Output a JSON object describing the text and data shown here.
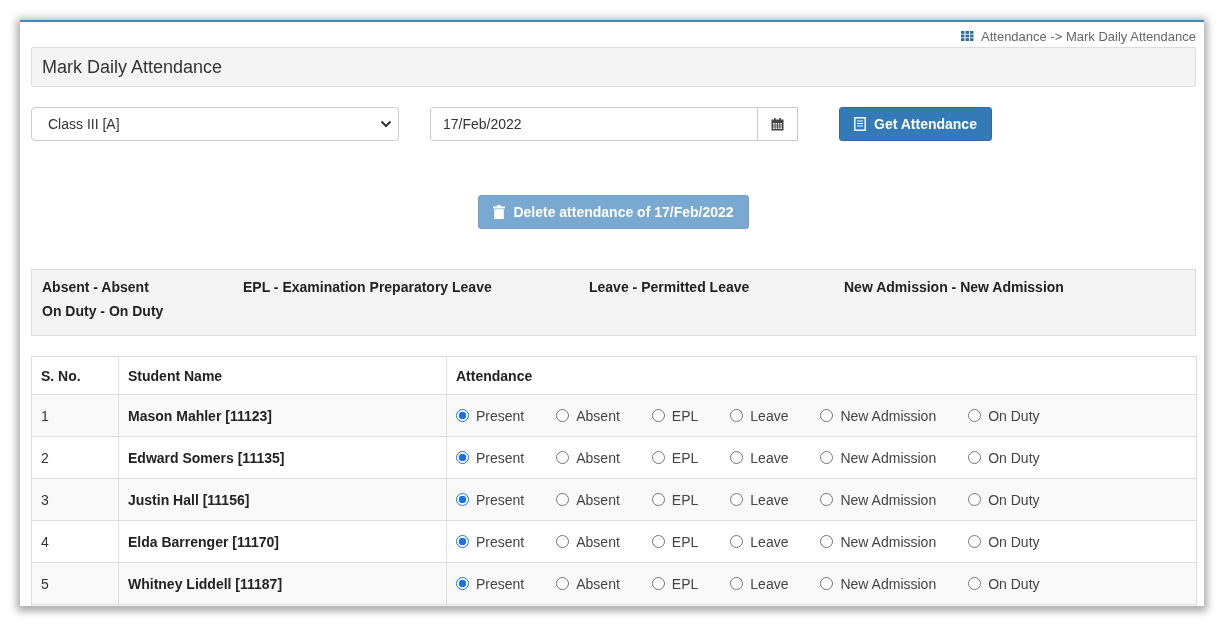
{
  "breadcrumb": "Attendance -> Mark Daily Attendance",
  "page_title": "Mark Daily Attendance",
  "class_select": {
    "value": "Class III [A]"
  },
  "date_field": {
    "value": "17/Feb/2022"
  },
  "get_button": "Get Attendance",
  "delete_button": {
    "label": "Delete attendance of 17/Feb/2022",
    "disabled": true
  },
  "legend": [
    "Absent - Absent",
    "EPL - Examination Preparatory Leave",
    "Leave - Permitted Leave",
    "New Admission - New Admission",
    "On Duty - On Duty"
  ],
  "table": {
    "columns": [
      "S. No.",
      "Student Name",
      "Attendance"
    ],
    "rows": [
      {
        "sno": "1",
        "name": "Mason Mahler [11123]",
        "options": [
          {
            "label": "Present",
            "selected": true
          },
          {
            "label": "Absent",
            "selected": false
          },
          {
            "label": "EPL",
            "selected": false
          },
          {
            "label": "Leave",
            "selected": false
          },
          {
            "label": "New Admission",
            "selected": false
          },
          {
            "label": "On Duty",
            "selected": false
          }
        ]
      },
      {
        "sno": "2",
        "name": "Edward Somers [11135]",
        "options": [
          {
            "label": "Present",
            "selected": true
          },
          {
            "label": "Absent",
            "selected": false
          },
          {
            "label": "EPL",
            "selected": false
          },
          {
            "label": "Leave",
            "selected": false
          },
          {
            "label": "New Admission",
            "selected": false
          },
          {
            "label": "On Duty",
            "selected": false
          }
        ]
      },
      {
        "sno": "3",
        "name": "Justin Hall [11156]",
        "options": [
          {
            "label": "Present",
            "selected": true
          },
          {
            "label": "Absent",
            "selected": false
          },
          {
            "label": "EPL",
            "selected": false
          },
          {
            "label": "Leave",
            "selected": false
          },
          {
            "label": "New Admission",
            "selected": false
          },
          {
            "label": "On Duty",
            "selected": false
          }
        ]
      },
      {
        "sno": "4",
        "name": "Elda Barrenger [11170]",
        "options": [
          {
            "label": "Present",
            "selected": true
          },
          {
            "label": "Absent",
            "selected": false
          },
          {
            "label": "EPL",
            "selected": false
          },
          {
            "label": "Leave",
            "selected": false
          },
          {
            "label": "New Admission",
            "selected": false
          },
          {
            "label": "On Duty",
            "selected": false
          }
        ]
      },
      {
        "sno": "5",
        "name": "Whitney Liddell [11187]",
        "options": [
          {
            "label": "Present",
            "selected": true
          },
          {
            "label": "Absent",
            "selected": false
          },
          {
            "label": "EPL",
            "selected": false
          },
          {
            "label": "Leave",
            "selected": false
          },
          {
            "label": "New Admission",
            "selected": false
          },
          {
            "label": "On Duty",
            "selected": false
          }
        ]
      }
    ]
  }
}
